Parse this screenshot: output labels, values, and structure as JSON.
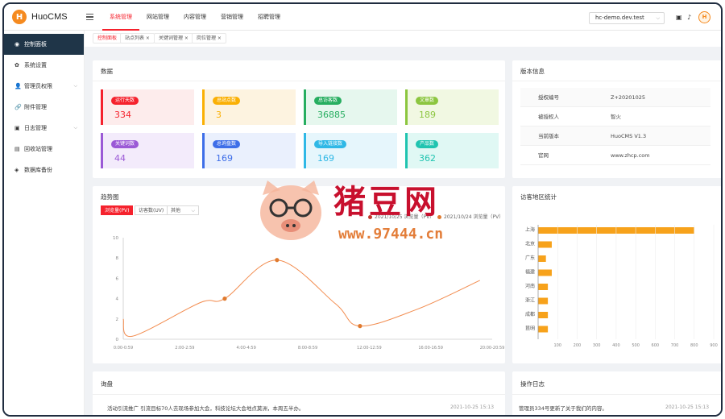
{
  "app": {
    "logo_glyph": "H",
    "name": "HuoCMS"
  },
  "topnav": [
    {
      "label": "系统管理",
      "active": true
    },
    {
      "label": "网站管理",
      "active": false
    },
    {
      "label": "内容管理",
      "active": false
    },
    {
      "label": "营销管理",
      "active": false
    },
    {
      "label": "招聘管理",
      "active": false
    }
  ],
  "site_select": {
    "value": "hc-demo.dev.test"
  },
  "sidebar": [
    {
      "label": "控制面板",
      "icon": "dashboard-icon",
      "glyph": "◉",
      "active": true,
      "arrow": false
    },
    {
      "label": "系统设置",
      "icon": "gear-icon",
      "glyph": "✿",
      "active": false,
      "arrow": false
    },
    {
      "label": "管理员权限",
      "icon": "user-icon",
      "glyph": "👤",
      "active": false,
      "arrow": true
    },
    {
      "label": "附件管理",
      "icon": "link-icon",
      "glyph": "🔗",
      "active": false,
      "arrow": false
    },
    {
      "label": "日志管理",
      "icon": "calendar-icon",
      "glyph": "▣",
      "active": false,
      "arrow": true
    },
    {
      "label": "回收站管理",
      "icon": "trash-icon",
      "glyph": "▤",
      "active": false,
      "arrow": false
    },
    {
      "label": "数据库备份",
      "icon": "database-icon",
      "glyph": "◈",
      "active": false,
      "arrow": false
    }
  ],
  "tabs": [
    {
      "label": "控制面板",
      "active": true
    },
    {
      "label": "站点列表 ×",
      "active": false
    },
    {
      "label": "关键词管理 ×",
      "active": false
    },
    {
      "label": "岗位管理 ×",
      "active": false
    }
  ],
  "data_card": {
    "title": "数据",
    "stats": [
      {
        "label": "运行天数",
        "value": "334",
        "color": "#f5222d",
        "bg": "#fdecec"
      },
      {
        "label": "总站点数",
        "value": "3",
        "color": "#fab005",
        "bg": "#fdf3e0"
      },
      {
        "label": "总访客数",
        "value": "36885",
        "color": "#27ae60",
        "bg": "#e6f7ee"
      },
      {
        "label": "文章数",
        "value": "189",
        "color": "#8cc63f",
        "bg": "#f1f8e2"
      },
      {
        "label": "关键词数",
        "value": "44",
        "color": "#9b59d6",
        "bg": "#f3ebfb"
      },
      {
        "label": "总询盘数",
        "value": "169",
        "color": "#3e6ee8",
        "bg": "#eaf0fd"
      },
      {
        "label": "导入链接数",
        "value": "169",
        "color": "#2fb8e6",
        "bg": "#e6f6fc"
      },
      {
        "label": "产品数",
        "value": "362",
        "color": "#20c4b0",
        "bg": "#e0f8f4"
      }
    ]
  },
  "version_card": {
    "title": "版本信息",
    "rows": [
      {
        "key": "授权编号",
        "value": "Z+20201025"
      },
      {
        "key": "被授权人",
        "value": "智火"
      },
      {
        "key": "当前版本",
        "value": "HuoCMS V1.3"
      },
      {
        "key": "官网",
        "value": "www.zhcp.com"
      }
    ]
  },
  "trend_card": {
    "title": "趋势图",
    "tabs": [
      {
        "label": "浏览量(PV)",
        "active": true
      },
      {
        "label": "访客数(UV)",
        "active": false
      },
      {
        "label": "其他",
        "active": false
      }
    ],
    "legend": [
      "2021/10/25 浏览量（PV）",
      "2021/10/24 浏览量（PV）"
    ]
  },
  "region_card": {
    "title": "访客地区统计"
  },
  "inquiry_card": {
    "title": "询盘",
    "rows": [
      {
        "text": "活动引流推广  引流目标70人去现场参加大会，科技论坛大会地点莫洲，本周五半办。",
        "time": "2021-10-25 15:13"
      }
    ]
  },
  "log_card": {
    "title": "操作日志",
    "rows": [
      {
        "text": "管理员334号更新了关于我们的内容。",
        "time": "2021-10-25 15:13"
      }
    ]
  },
  "watermark": {
    "text": "猪豆网",
    "url": "www.97444.cn"
  },
  "chart_data": [
    {
      "type": "line",
      "title": "",
      "x": [
        "0:00-0:59",
        "2:00-2:59",
        "4:00-4:59",
        "8:00-8:59",
        "12:00-12:59",
        "16:00-16:59",
        "20:00-20:59"
      ],
      "points": [
        [
          0,
          2.0
        ],
        [
          0.3,
          0.3
        ],
        [
          2.5,
          3.6
        ],
        [
          3.3,
          4.0
        ],
        [
          5.0,
          7.8
        ],
        [
          6.9,
          3.5
        ],
        [
          7.7,
          1.3
        ],
        [
          9.6,
          3.0
        ],
        [
          11.6,
          5.8
        ]
      ],
      "point_categories": [
        "0:00-0:59",
        "",
        "",
        "4:00-4:59",
        "8:00-8:59",
        "",
        "",
        "",
        "20:00-20:59"
      ],
      "markers": [
        3,
        4,
        6
      ],
      "series": [
        {
          "name": "2021/10/25 浏览量（PV）",
          "color": "#f28c4f"
        }
      ],
      "ylim": [
        0,
        10
      ],
      "yticks": [
        0,
        2,
        4,
        6,
        8,
        10
      ]
    },
    {
      "type": "bar",
      "orientation": "horizontal",
      "categories": [
        "上海",
        "北京",
        "广东",
        "福建",
        "河南",
        "浙江",
        "成都",
        "昆明"
      ],
      "values": [
        800,
        70,
        40,
        70,
        50,
        50,
        50,
        50
      ],
      "xlim": [
        0,
        900
      ],
      "xticks": [
        100,
        200,
        300,
        400,
        500,
        600,
        700,
        800,
        900
      ],
      "color": "#f7a21b"
    }
  ]
}
